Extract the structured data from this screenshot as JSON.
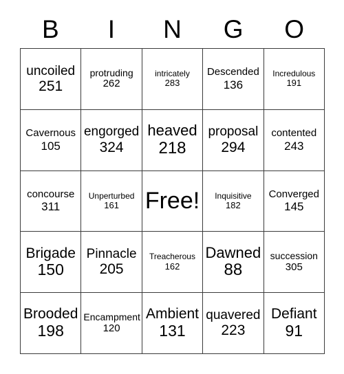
{
  "card": {
    "header_letters": [
      "B",
      "I",
      "N",
      "G",
      "O"
    ],
    "free_space_label": "Free!",
    "rows": [
      [
        {
          "word": "uncoiled",
          "number": "251"
        },
        {
          "word": "protruding",
          "number": "262"
        },
        {
          "word": "intricately",
          "number": "283"
        },
        {
          "word": "Descended",
          "number": "136"
        },
        {
          "word": "Incredulous",
          "number": "191"
        }
      ],
      [
        {
          "word": "Cavernous",
          "number": "105"
        },
        {
          "word": "engorged",
          "number": "324"
        },
        {
          "word": "heaved",
          "number": "218"
        },
        {
          "word": "proposal",
          "number": "294"
        },
        {
          "word": "contented",
          "number": "243"
        }
      ],
      [
        {
          "word": "concourse",
          "number": "311"
        },
        {
          "word": "Unperturbed",
          "number": "161"
        },
        {
          "word": "Free!",
          "number": ""
        },
        {
          "word": "Inquisitive",
          "number": "182"
        },
        {
          "word": "Converged",
          "number": "145"
        }
      ],
      [
        {
          "word": "Brigade",
          "number": "150"
        },
        {
          "word": "Pinnacle",
          "number": "205"
        },
        {
          "word": "Treacherous",
          "number": "162"
        },
        {
          "word": "Dawned",
          "number": "88"
        },
        {
          "word": "succession",
          "number": "305"
        }
      ],
      [
        {
          "word": "Brooded",
          "number": "198"
        },
        {
          "word": "Encampment",
          "number": "120"
        },
        {
          "word": "Ambient",
          "number": "131"
        },
        {
          "word": "quavered",
          "number": "223"
        },
        {
          "word": "Defiant",
          "number": "91"
        }
      ]
    ]
  },
  "style": {
    "text_color": "#000000",
    "grid_line_color": "#3a3a3a",
    "background_color": "#ffffff"
  }
}
